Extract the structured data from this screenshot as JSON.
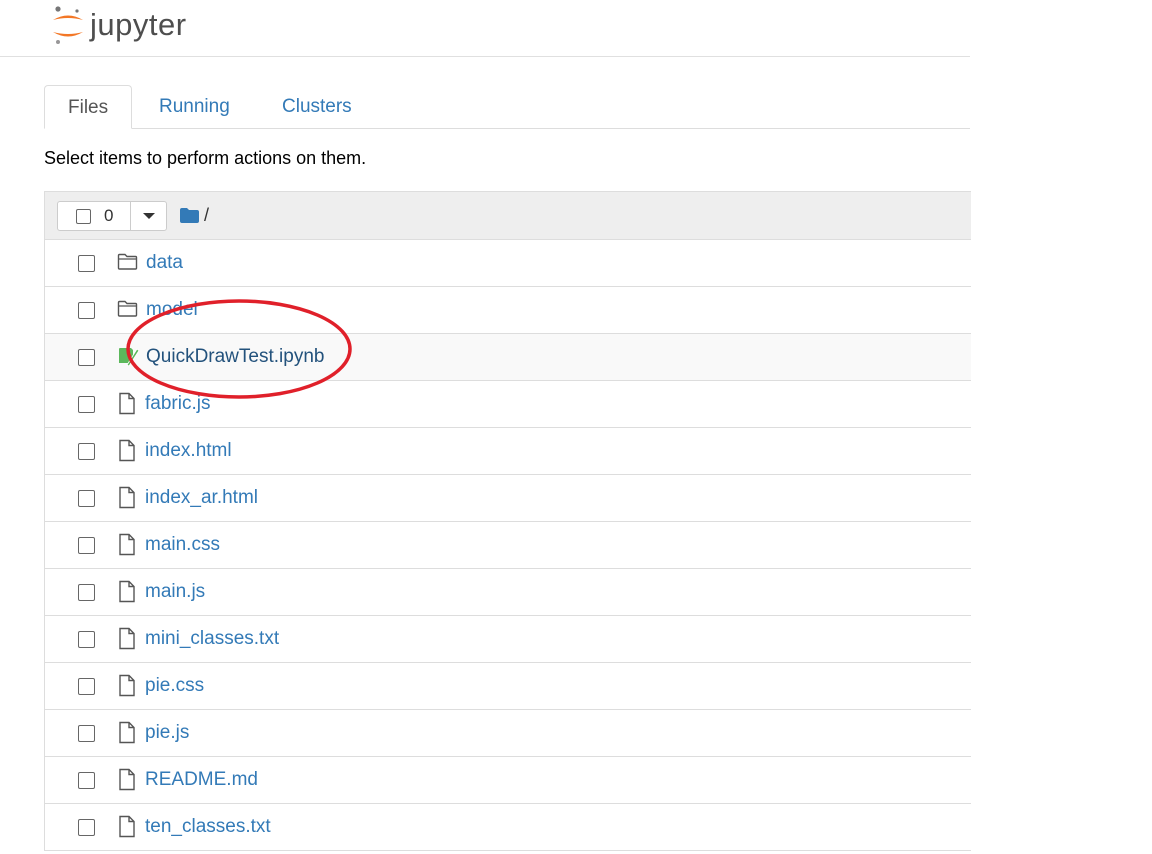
{
  "header": {
    "logo_text": "jupyter"
  },
  "tabs": [
    {
      "label": "Files",
      "active": true
    },
    {
      "label": "Running",
      "active": false
    },
    {
      "label": "Clusters",
      "active": false
    }
  ],
  "hint": "Select items to perform actions on them.",
  "toolbar": {
    "selected_count": "0",
    "breadcrumb": "/"
  },
  "files": [
    {
      "name": "data",
      "type": "folder",
      "icon": "folder-icon"
    },
    {
      "name": "model",
      "type": "folder",
      "icon": "folder-icon"
    },
    {
      "name": "QuickDrawTest.ipynb",
      "type": "notebook",
      "icon": "notebook-icon"
    },
    {
      "name": "fabric.js",
      "type": "file",
      "icon": "file-icon"
    },
    {
      "name": "index.html",
      "type": "file",
      "icon": "file-icon"
    },
    {
      "name": "index_ar.html",
      "type": "file",
      "icon": "file-icon"
    },
    {
      "name": "main.css",
      "type": "file",
      "icon": "file-icon"
    },
    {
      "name": "main.js",
      "type": "file",
      "icon": "file-icon"
    },
    {
      "name": "mini_classes.txt",
      "type": "file",
      "icon": "file-icon"
    },
    {
      "name": "pie.css",
      "type": "file",
      "icon": "file-icon"
    },
    {
      "name": "pie.js",
      "type": "file",
      "icon": "file-icon"
    },
    {
      "name": "README.md",
      "type": "file",
      "icon": "file-icon"
    },
    {
      "name": "ten_classes.txt",
      "type": "file",
      "icon": "file-icon"
    }
  ],
  "colors": {
    "link": "#337ab7",
    "logo_orange": "#f37726",
    "annotation": "#e0202a",
    "notebook_green": "#5cb85c"
  }
}
